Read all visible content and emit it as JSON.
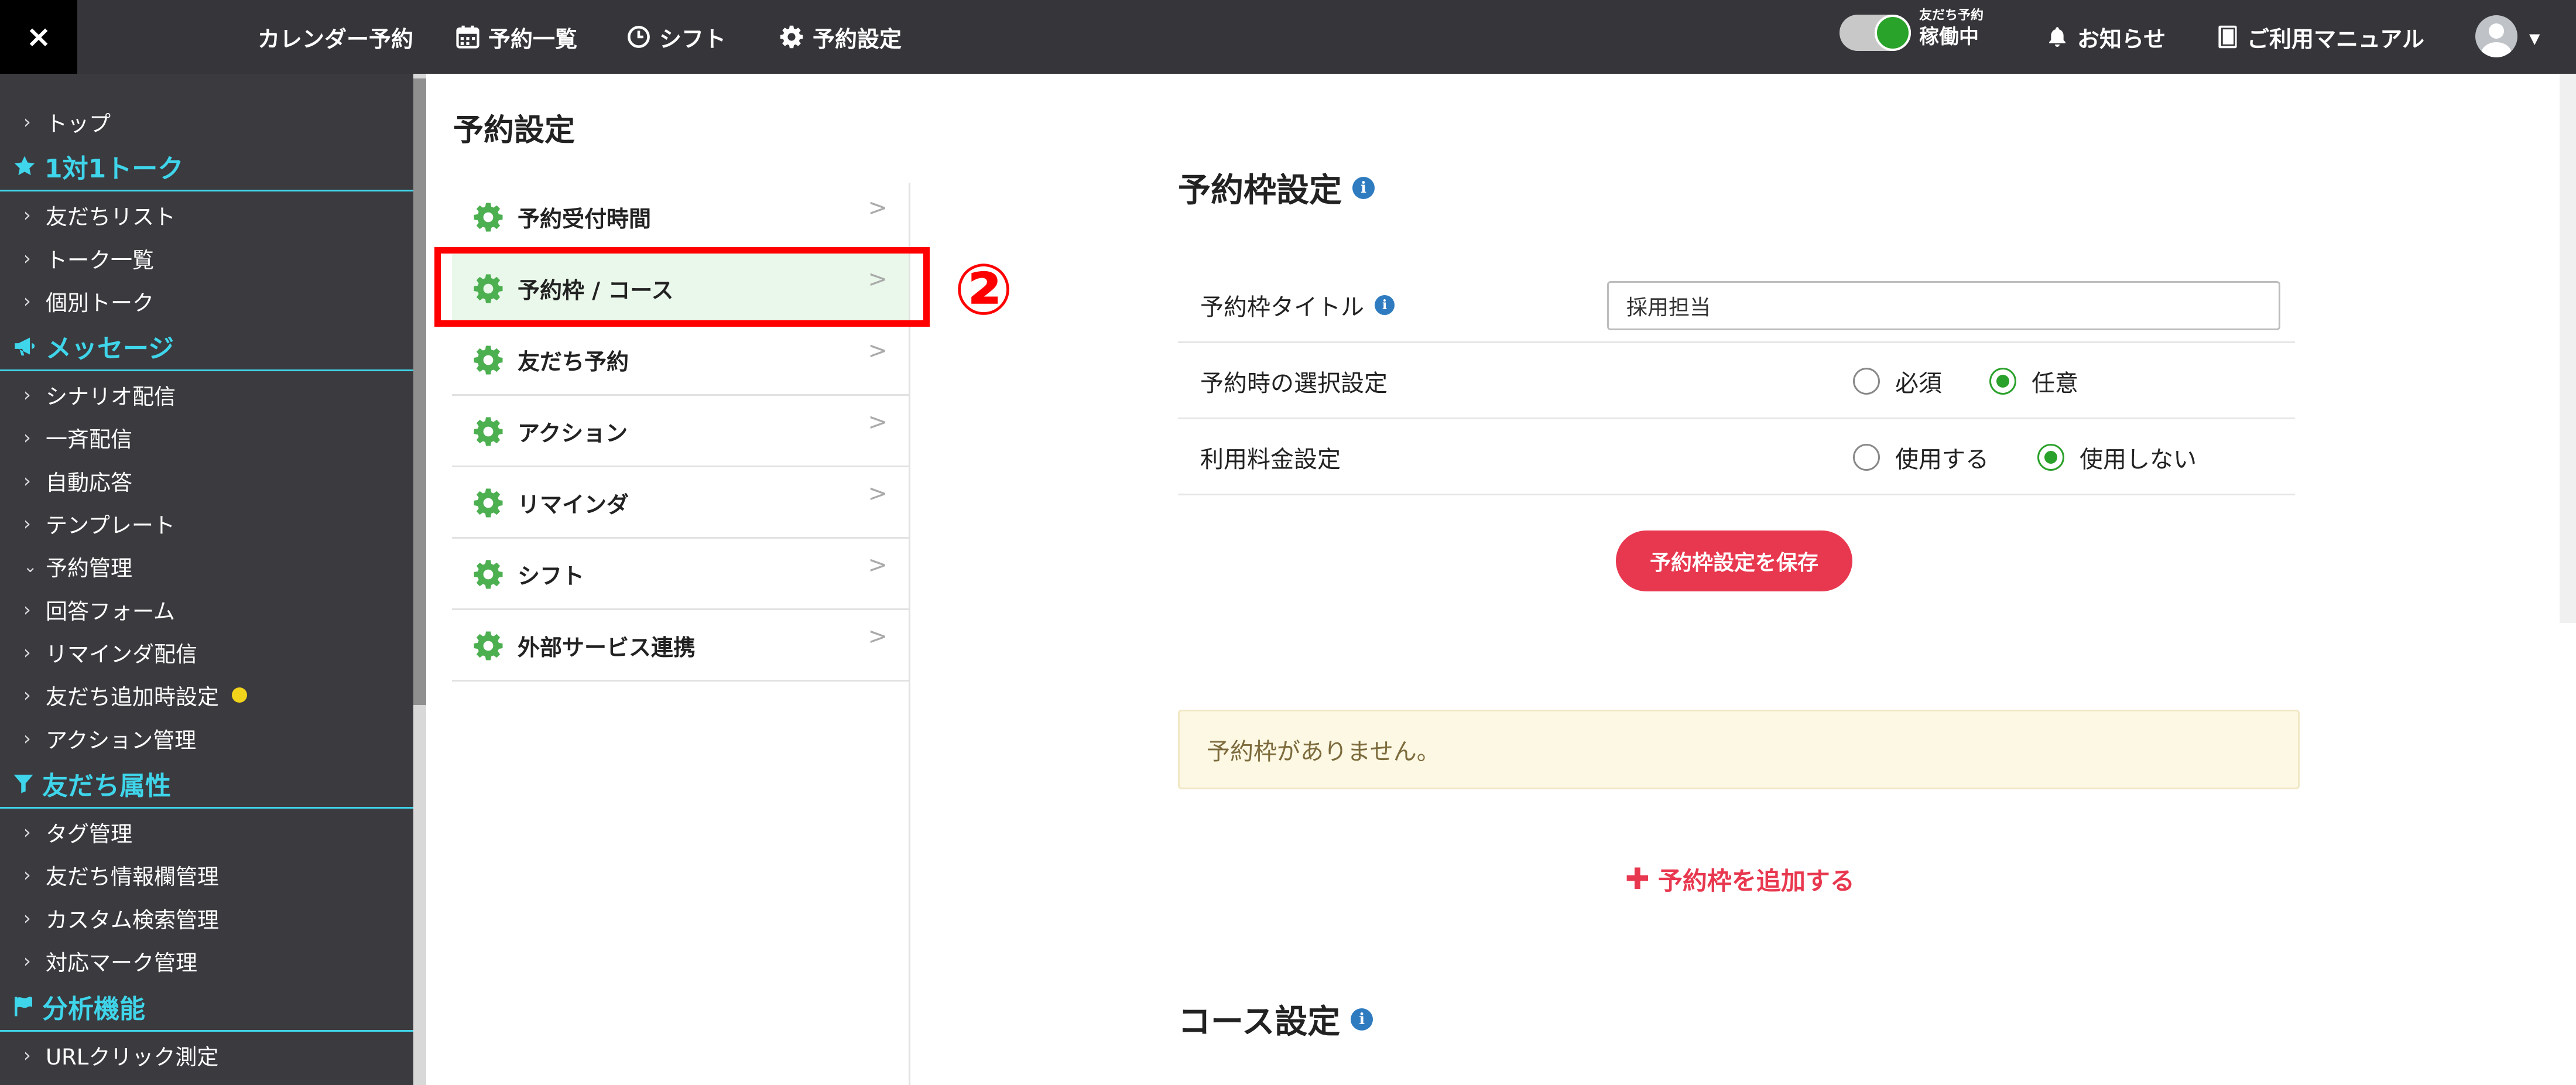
{
  "header": {
    "close_icon": "×",
    "nav": [
      {
        "label": "カレンダー予約",
        "icon": ""
      },
      {
        "label": "予約一覧",
        "icon": "calendar-icon"
      },
      {
        "label": "シフト",
        "icon": "clock-icon"
      },
      {
        "label": "予約設定",
        "icon": "gear-icon"
      }
    ],
    "status_small": "友だち予約",
    "status_label": "稼働中",
    "notifications_label": "お知らせ",
    "manual_label": "ご利用マニュアル"
  },
  "sidebar": {
    "top": "トップ",
    "sections": [
      {
        "title": "1対1トーク",
        "icon": "star-icon",
        "items": [
          "友だちリスト",
          "トーク一覧",
          "個別トーク"
        ]
      },
      {
        "title": "メッセージ",
        "icon": "megaphone-icon",
        "items": [
          "シナリオ配信",
          "一斉配信",
          "自動応答",
          "テンプレート",
          "予約管理",
          "回答フォーム",
          "リマインダ配信",
          "友だち追加時設定",
          "アクション管理"
        ]
      },
      {
        "title": "友だち属性",
        "icon": "filter-icon",
        "items": [
          "タグ管理",
          "友だち情報欄管理",
          "カスタム検索管理",
          "対応マーク管理"
        ]
      },
      {
        "title": "分析機能",
        "icon": "flag-icon",
        "items": [
          "URLクリック測定"
        ]
      }
    ],
    "expanded_item": "予約管理",
    "new_badge_item": "友だち追加時設定",
    "accent_color": "#3fd5ea"
  },
  "page": {
    "title": "予約設定",
    "menu": [
      "予約受付時間",
      "予約枠 / コース",
      "友だち予約",
      "アクション",
      "リマインダ",
      "シフト",
      "外部サービス連携"
    ],
    "active_menu_index": 1,
    "step_marker": "②"
  },
  "slot_settings": {
    "title": "予約枠設定",
    "title_field_label": "予約枠タイトル",
    "title_field_value": "採用担当",
    "selection_label": "予約時の選択設定",
    "selection_options": [
      "必須",
      "任意"
    ],
    "selection_selected": "任意",
    "fee_label": "利用料金設定",
    "fee_options": [
      "使用する",
      "使用しない"
    ],
    "fee_selected": "使用しない",
    "save_button": "予約枠設定を保存",
    "empty_message": "予約枠がありません。",
    "add_link": "予約枠を追加する"
  },
  "course_settings": {
    "title": "コース設定"
  },
  "colors": {
    "topbar": "#35353a",
    "sidebar": "#3a3a3f",
    "primary_red": "#e8384f",
    "radio_green": "#2aa12a",
    "gear_green": "#4caf50",
    "highlight_red": "#ff0000",
    "info_blue": "#2e7bc0"
  }
}
